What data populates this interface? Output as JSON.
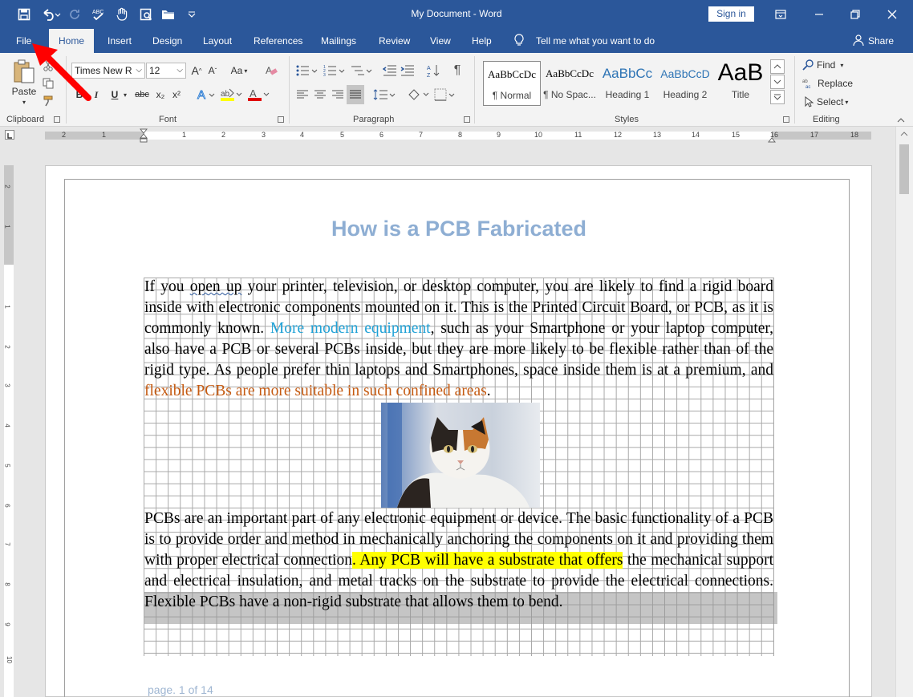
{
  "titlebar": {
    "title": "My Document  -  Word",
    "signin_label": "Sign in",
    "qat_icons": [
      "save-icon",
      "undo-icon",
      "redo-icon",
      "spelling-icon",
      "touch-mode-icon",
      "print-preview-icon",
      "open-folder-icon",
      "customize-qat-icon"
    ]
  },
  "tabs": {
    "items": [
      "File",
      "Home",
      "Insert",
      "Design",
      "Layout",
      "References",
      "Mailings",
      "Review",
      "View",
      "Help"
    ],
    "active": "Home",
    "tell_me": "Tell me what you want to do",
    "share": "Share"
  },
  "ribbon": {
    "clipboard": {
      "paste_label": "Paste",
      "group_label": "Clipboard"
    },
    "font": {
      "font_name": "Times New R",
      "font_size": "12",
      "case_label": "Aa",
      "bold": "B",
      "italic": "I",
      "underline": "U",
      "strike": "abc",
      "sub": "x₂",
      "sup": "x²",
      "group_label": "Font"
    },
    "paragraph": {
      "group_label": "Paragraph"
    },
    "styles": {
      "items": [
        {
          "sample": "AaBbCcDc",
          "name": "¶ Normal"
        },
        {
          "sample": "AaBbCcDc",
          "name": "¶ No Spac..."
        },
        {
          "sample": "AaBbCc",
          "name": "Heading 1"
        },
        {
          "sample": "AaBbCcD",
          "name": "Heading 2"
        },
        {
          "sample": "AaB",
          "name": "Title"
        }
      ],
      "group_label": "Styles"
    },
    "editing": {
      "find": "Find",
      "replace": "Replace",
      "select": "Select",
      "group_label": "Editing"
    }
  },
  "ruler": {
    "numbers": [
      "2",
      "1",
      "1",
      "2",
      "3",
      "4",
      "5",
      "6",
      "7",
      "8",
      "9",
      "10",
      "11",
      "12",
      "13",
      "14",
      "15",
      "16",
      "17",
      "18"
    ],
    "vnumbers": [
      "2",
      "1",
      "1",
      "2",
      "3",
      "4",
      "5",
      "6",
      "7",
      "8",
      "9",
      "10"
    ]
  },
  "document": {
    "heading": "How is a PCB Fabricated",
    "para1": {
      "s1a": "If you ",
      "s1b": "open up",
      "s1c": " your printer, television, or desktop computer, you are likely to find a rigid board inside with electronic components mounted on it. This is the Printed Circuit Board, or PCB, as it is commonly known. ",
      "link": "More modern equipment",
      "s2": ", such as your Smartphone or your laptop computer, also have a PCB or several PCBs inside, but they are more likely to be flexible rather than of the rigid type. As people prefer thin laptops and Smartphones, space inside them is at a premium, and ",
      "orange": "flexible PCBs are more suitable in such confined areas",
      "s3": "."
    },
    "para2": {
      "s1": "PCBs are an important part of any electronic equipment or device. The basic functionality of a PCB is to provide order and method in mechanically anchoring the components on it and providing them with proper electrical connection",
      "highlight": ". Any PCB will have a substrate that offers",
      "s2": " the mechanical support and electrical insulation, and metal tracks on the substrate to provide the electrical connections. Flexible PCBs have a non-rigid substrate that allows them to bend."
    },
    "footer": "page. 1 of 14"
  },
  "colors": {
    "accent": "#2b579a",
    "heading": "#8eaed3",
    "link": "#1fa1d6",
    "orange": "#c55a11",
    "highlight": "#ffff00",
    "annotation_arrow": "#ff0000"
  }
}
